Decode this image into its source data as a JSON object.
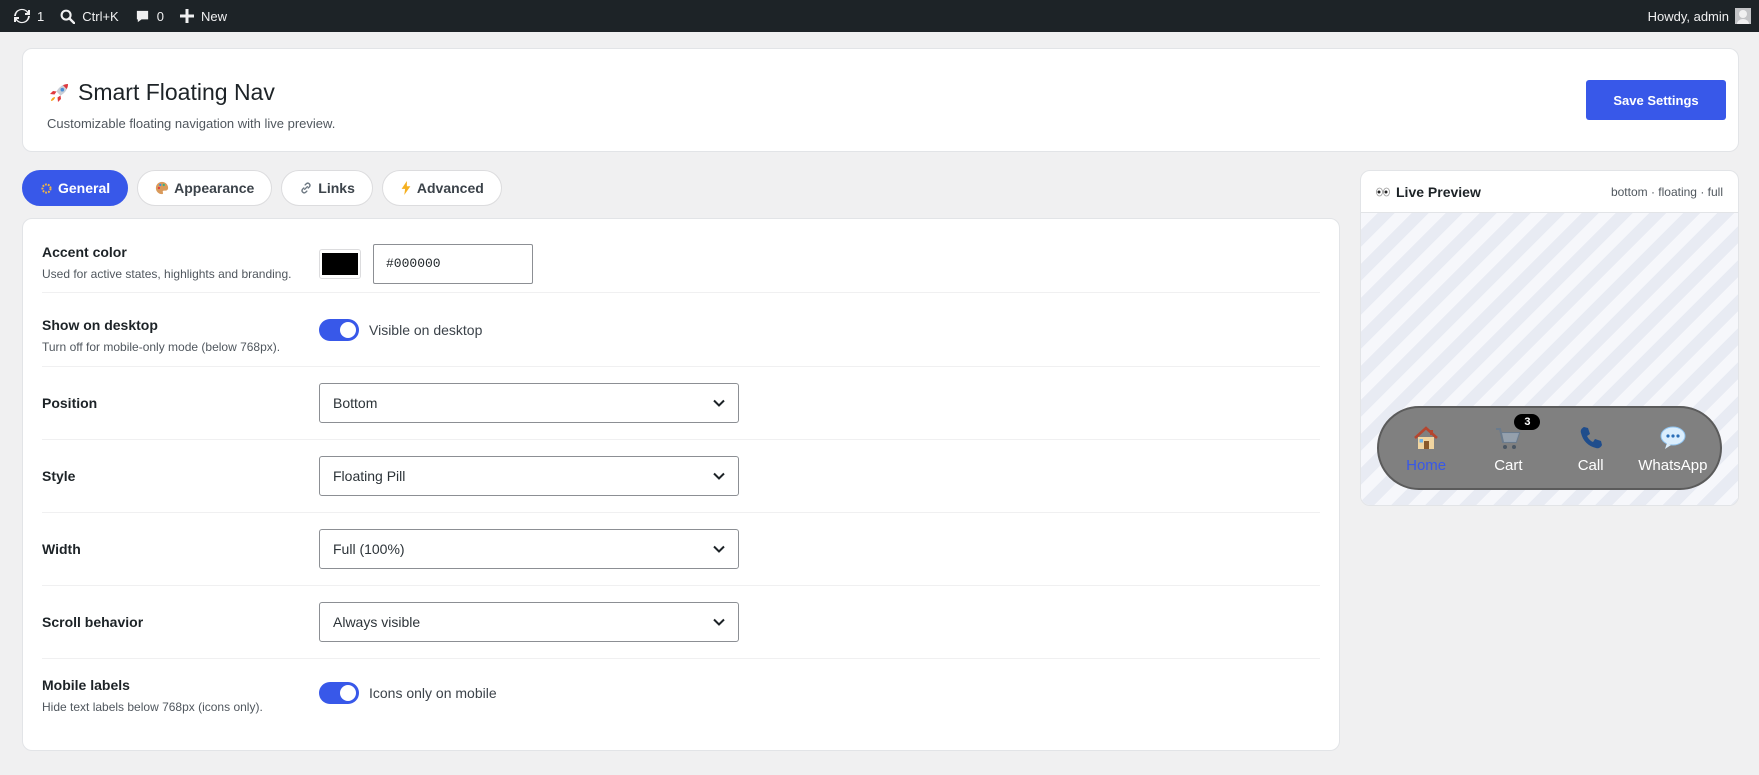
{
  "adminbar": {
    "updates_count": "1",
    "search_shortcut": "Ctrl+K",
    "comments_count": "0",
    "new_label": "New",
    "greeting": "Howdy, admin"
  },
  "header": {
    "title": "Smart Floating Nav",
    "subtitle": "Customizable floating navigation with live preview.",
    "save_label": "Save Settings"
  },
  "tabs": [
    {
      "label": "General",
      "icon": "gear-icon",
      "active": true
    },
    {
      "label": "Appearance",
      "icon": "palette-icon",
      "active": false
    },
    {
      "label": "Links",
      "icon": "link-icon",
      "active": false
    },
    {
      "label": "Advanced",
      "icon": "lightning-icon",
      "active": false
    }
  ],
  "settings": {
    "accent": {
      "label": "Accent color",
      "help": "Used for active states, highlights and branding.",
      "value": "#000000"
    },
    "desktop": {
      "label": "Show on desktop",
      "help": "Turn off for mobile-only mode (below 768px).",
      "toggle_text": "Visible on desktop",
      "on": true
    },
    "position": {
      "label": "Position",
      "value": "Bottom"
    },
    "style": {
      "label": "Style",
      "value": "Floating Pill"
    },
    "width": {
      "label": "Width",
      "value": "Full (100%)"
    },
    "scroll": {
      "label": "Scroll behavior",
      "value": "Always visible"
    },
    "mobile_labels": {
      "label": "Mobile labels",
      "help": "Hide text labels below 768px (icons only).",
      "toggle_text": "Icons only on mobile",
      "on": true
    }
  },
  "preview": {
    "title": "Live Preview",
    "meta": "bottom · floating · full",
    "items": [
      {
        "label": "Home",
        "icon": "house-icon",
        "active": true
      },
      {
        "label": "Cart",
        "icon": "cart-icon",
        "badge": "3"
      },
      {
        "label": "Call",
        "icon": "phone-icon"
      },
      {
        "label": "WhatsApp",
        "icon": "chat-icon"
      }
    ]
  },
  "colors": {
    "accent_blue": "#3858e9",
    "adminbar_bg": "#1d2327",
    "nav_bg": "#808080"
  }
}
